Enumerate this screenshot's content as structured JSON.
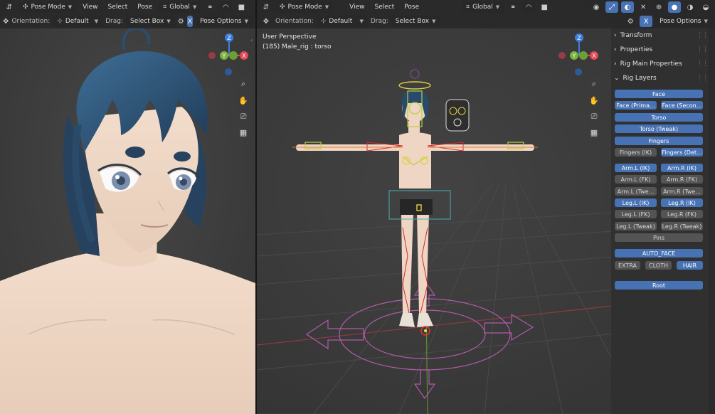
{
  "left_header": {
    "mode": "Pose Mode",
    "menus": [
      "View",
      "Select",
      "Pose"
    ],
    "transform": "Global",
    "orientation_label": "Orientation:",
    "orientation_value": "Default",
    "drag_label": "Drag:",
    "drag_value": "Select Box",
    "pose_options": "Pose Options"
  },
  "right_header": {
    "mode": "Pose Mode",
    "menus": [
      "View",
      "Select",
      "Pose"
    ],
    "transform": "Global",
    "orientation_label": "Orientation:",
    "orientation_value": "Default",
    "drag_label": "Drag:",
    "drag_value": "Select Box",
    "pose_options": "Pose Options"
  },
  "viewport": {
    "perspective": "User Perspective",
    "object_info": "(185) Male_rig : torso"
  },
  "gizmo": {
    "z": "Z",
    "y": "Y",
    "x": "X"
  },
  "npanel": {
    "sections": [
      "Transform",
      "Properties",
      "Rig Main Properties",
      "Rig Layers"
    ],
    "rig_layers": {
      "face": "Face",
      "face_primary": "Face (Prima...",
      "face_secondary": "Face (Secon...",
      "torso": "Torso",
      "torso_tweak": "Torso (Tweak)",
      "fingers": "Fingers",
      "fingers_ik": "Fingers (IK)",
      "fingers_detail": "Fingers (Det...",
      "arm_l_ik": "Arm.L (IK)",
      "arm_r_ik": "Arm.R (IK)",
      "arm_l_fk": "Arm.L (FK)",
      "arm_r_fk": "Arm.R (FK)",
      "arm_l_tweak": "Arm.L (Twe...",
      "arm_r_tweak": "Arm.R (Twe...",
      "leg_l_ik": "Leg.L (IK)",
      "leg_r_ik": "Leg.R (IK)",
      "leg_l_fk": "Leg.L (FK)",
      "leg_r_fk": "Leg.R (FK)",
      "leg_l_tweak": "Leg.L (Tweak)",
      "leg_r_tweak": "Leg.R (Tweak)",
      "pins": "Pins",
      "auto_face": "AUTO_FACE",
      "extra": "EXTRA",
      "cloth": "CLOTH",
      "hair": "HAIR",
      "root": "Root"
    }
  },
  "colors": {
    "accent": "#4772b3",
    "x_axis": "#e04a55",
    "y_axis": "#7ab33a",
    "z_axis": "#3a7ee0"
  }
}
